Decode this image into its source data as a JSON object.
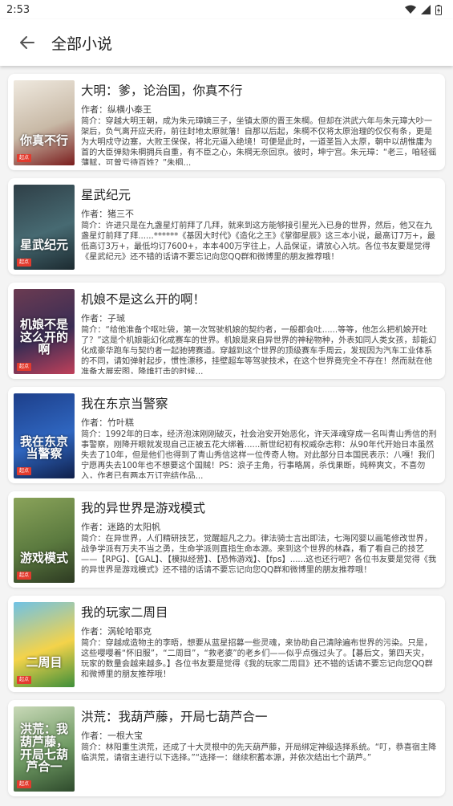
{
  "status_bar": {
    "time": "2:53"
  },
  "app_bar": {
    "title": "全部小说"
  },
  "author_prefix": "作者：",
  "intro_prefix": "简介：",
  "books": [
    {
      "title": "大明：爹，论治国，你真不行",
      "author": "纵横小秦王",
      "intro": "穿越大明王朝，成为朱元璋嫡三子，坐镇太原的晋王朱棡。但却在洪武六年与朱元璋大吵一架后，负气离开应天府，前往封地太原就藩！自那以后起，朱棡不仅将太原治理的仅仅有条，更是为大明戍守边塞，大败王保保，将北元逼入绝境！可便是此时，一道圣旨入太原，朝中以胡惟庸为首的大臣弹劾朱棡拥兵自重，有不臣之心，朱棡无奈回京。彼时，坤宁宫。朱元璋：“老三，咱轻徭薄赋，可曾亏待百姓？”朱棡...",
      "cover_title": "你真不行",
      "cover_colors": [
        "#efe9df",
        "#c8b9a6",
        "#7a1d1d"
      ]
    },
    {
      "title": "星武纪元",
      "author": "猪三不",
      "intro": "许进只是在九盏星灯前拜了几拜，就来到这方能够接引星光入已身的世界，然后，他又在九盏星灯前拜了拜......******《基因大时代》《造化之王》《掌御星辰》这三本小说，最高订7万+，最低高订3万+，最低均订7600+，本本400万字往上，人品保证，请放心入坑。各位书友要是觉得《星武纪元》还不错的话请不要忘记向您QQ群和微博里的朋友推荐哦！",
      "cover_title": "星武纪元",
      "cover_colors": [
        "#2f3f47",
        "#476a72",
        "#1c2a30"
      ]
    },
    {
      "title": "机娘不是这么开的啊！",
      "author": "子珹",
      "intro": "“给他准备个呕吐袋，第一次驾驶机娘的契约者，一般都会吐......等等，他怎么把机娘开吐了？”这是个机娘能幻化成赛车的世界。机娘是来自异世界的神秘物种，外表如同人类女孩，却能幻化成豪华跑车与契约者一起驰骋赛道。穿越到这个世界的顶级赛车手周云，发现因为汽车工业体系的不同，请如弹射起步，惯性漂移，挂壁超车等驾驶技术，在这个世界竟完全不存在！然而就在他准备大展宏图，降维打击的时候...",
      "cover_title": "机娘不是这么开的啊",
      "cover_colors": [
        "#6b3b52",
        "#3a2d54",
        "#c0405a"
      ]
    },
    {
      "title": "我在东京当警察",
      "author": "竹叶糕",
      "intro": "1992年的日本，经济泡沫刚刚破灭，社会治安开始恶化，许天泽魂穿成一名叫青山秀信的刑事警察，刚降开眼就发现自己正被五花大绑着......新世纪初有权威杂志称：从90年代开始日本虽然失去了10年，但是他们也得到了青山秀信这样一位传奇人物。对此部分日本国民表示：八嘎！我们宁愿再失去100年也不想要这个国贼！PS：浪子主角，行事略屑，杀伐果断，纯粹爽文，不喜勿入，作者已有两本万订完结作品...",
      "cover_title": "我在东京当警察",
      "cover_colors": [
        "#1d3f8a",
        "#2f66c0",
        "#0f1f4a"
      ]
    },
    {
      "title": "我的异世界是游戏模式",
      "author": "迷路的太阳帆",
      "intro": "在异世界，人们精研技艺，觉醒超凡之力。律法骑士言出即法，七海冈婴以画笔修改世界，战争学派有万夫不当之勇，生命学派则直指生命本源。来到这个世界的林森，看了看自己的技艺——【RPG】、【GAL】、【模拟经营】、【恐怖游戏】、【fps】......这也还行吧？各位书友要是觉得《我的异世界是游戏模式》还不错的话请不要忘记向您QQ群和微博里的朋友推荐哦！",
      "cover_title": "游戏模式",
      "cover_colors": [
        "#8aa35a",
        "#5b7a3f",
        "#2d3a22"
      ]
    },
    {
      "title": "我的玩家二周目",
      "author": "涡轮哈耶克",
      "intro": "穿越成造物主的李晤，想要从蓝星招募一些灵魂，来协助自己清除遍布世界的污染。只是，这些嘤嘤着“怀旧服”，“二周目”，“救老婆”的老乡们——似乎点强过头了。【碁后文，第四天灾，玩家的数量会越来越多。】各位书友要是觉得《我的玩家二周目》还不错的话请不要忘记向您QQ群和微博里的朋友推荐哦！",
      "cover_title": "二周目",
      "cover_colors": [
        "#6fc2e6",
        "#f4d34a",
        "#3f8f3a"
      ]
    },
    {
      "title": "洪荒：我葫芦藤，开局七葫芦合一",
      "author": "一根大宝",
      "intro": "林阳重生洪荒，还成了十大灵根中的先天葫芦藤，开局绑定神级选择系统。“叮，恭喜宿主降临洪荒，请宿主进行以下选择。”“选择一：继续积蓄本源，并依次结出七个葫芦。”",
      "cover_title": "洪荒：我葫芦藤，开局七葫芦合一",
      "cover_colors": [
        "#c9d9b8",
        "#6f9a63",
        "#2e4a2c"
      ]
    }
  ],
  "colors": {
    "accent_badge": "#e33b2e",
    "background": "#f4f4f4"
  }
}
